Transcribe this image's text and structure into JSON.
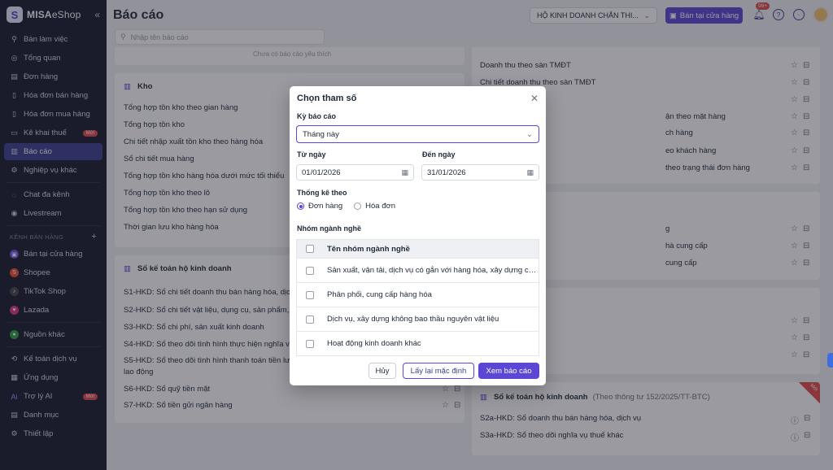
{
  "brand": {
    "name_bold": "MISA",
    "name_light": "eShop"
  },
  "sidebar": {
    "items": [
      {
        "label": "Bàn làm việc",
        "icon": "workspace-icon"
      },
      {
        "label": "Tổng quan",
        "icon": "dashboard-icon"
      },
      {
        "label": "Đơn hàng",
        "icon": "order-icon"
      },
      {
        "label": "Hóa đơn bán hàng",
        "icon": "invoice-icon"
      },
      {
        "label": "Hóa đơn mua hàng",
        "icon": "purchase-invoice-icon"
      },
      {
        "label": "Kê khai thuế",
        "icon": "tax-icon",
        "badge": "Mới"
      },
      {
        "label": "Báo cáo",
        "icon": "report-icon"
      },
      {
        "label": "Nghiệp vụ khác",
        "icon": "other-icon"
      },
      {
        "label": "Chat đa kênh",
        "icon": "chat-icon"
      },
      {
        "label": "Livestream",
        "icon": "livestream-icon"
      }
    ],
    "section_label": "KÊNH BÁN HÀNG",
    "channels": [
      {
        "label": "Bán tại cửa hàng",
        "color": "#6a4fd8"
      },
      {
        "label": "Shopee",
        "color": "#ee4d2d"
      },
      {
        "label": "TikTok Shop",
        "color": "#222222"
      },
      {
        "label": "Lazada",
        "color": "#e0327a"
      }
    ],
    "others": [
      {
        "label": "Nguồn khác",
        "color": "#2ea043"
      },
      {
        "label": "Kế toán dịch vụ",
        "icon": "accounting-icon"
      },
      {
        "label": "Ứng dụng",
        "icon": "apps-icon"
      },
      {
        "label": "Trợ lý AI",
        "icon": "ai-icon",
        "badge": "Mới"
      },
      {
        "label": "Danh mục",
        "icon": "catalog-icon"
      },
      {
        "label": "Thiết lập",
        "icon": "settings-icon"
      }
    ]
  },
  "header": {
    "title": "Báo cáo",
    "search_placeholder": "Nhập tên báo cáo",
    "store": "HỘ KINH DOANH CHẮN THI...",
    "sell_button": "Bán tại cửa hàng",
    "notif_count": "99+"
  },
  "left_top": {
    "empty": "Chưa có báo cáo yêu thích"
  },
  "kho": {
    "title": "Kho",
    "rows": [
      "Tổng hợp tồn kho theo gian hàng",
      "Tổng hợp tồn kho",
      "Chi tiết nhập xuất tồn kho theo hàng hóa",
      "Sổ chi tiết mua hàng",
      "Tổng hợp tồn kho hàng hóa dưới mức tối thiểu",
      "Tổng hợp tồn kho theo lô",
      "Tổng hợp tồn kho theo hạn sử dụng",
      "Thời gian lưu kho hàng hóa"
    ]
  },
  "ledger": {
    "title": "Sổ kế toán hộ kinh doanh",
    "rows": [
      "S1-HKD: Sổ chi tiết doanh thu bán hàng hóa, dịch",
      "S2-HKD: Sổ chi tiết vật liệu, dụng cụ, sản phẩm, h",
      "S3-HKD: Sổ chi phí, sản xuất kinh doanh",
      "S4-HKD: Sổ theo dõi tình hình thực hiện nghĩa vụ",
      "S5-HKD: Sổ theo dõi tình hình thanh toán tiền lươ",
      "lao động",
      "S6-HKD: Sổ quỹ tiền mặt",
      "S7-HKD: Sổ tiền gửi ngân hàng"
    ]
  },
  "right_top": {
    "rows": [
      "Doanh thu theo sàn TMĐT",
      "Chi tiết doanh thu theo sàn TMĐT",
      "ận theo mặt hàng",
      "ch hàng",
      "eo khách hàng",
      "theo trạng thái đơn hàng"
    ]
  },
  "right_mid": {
    "rows": [
      "g",
      "hà cung cấp",
      "cung cấp"
    ]
  },
  "right_ledger": {
    "title": "Sổ kế toán hộ kinh doanh",
    "subtitle": "(Theo thông tư 152/2025/TT-BTC)",
    "ribbon": "Mới",
    "rows": [
      "S2a-HKD: Sổ doanh thu bán hàng hóa, dịch vụ",
      "S3a-HKD: Sổ theo dõi nghĩa vụ thuế khác"
    ]
  },
  "modal": {
    "title": "Chọn tham số",
    "period_label": "Kỳ báo cáo",
    "period_value": "Tháng này",
    "from_label": "Từ ngày",
    "from_value": "01/01/2026",
    "to_label": "Đến ngày",
    "to_value": "31/01/2026",
    "stat_label": "Thống kê theo",
    "radio_order": "Đơn hàng",
    "radio_invoice": "Hóa đơn",
    "group_label": "Nhóm ngành nghề",
    "grid_header": "Tên nhóm ngành nghề",
    "grid_rows": [
      "Sản xuất, vận tải, dịch vụ có gắn với hàng hóa, xây dựng có...",
      "Phân phối, cung cấp hàng hóa",
      "Dịch vụ, xây dựng không bao thầu nguyên vật liệu",
      "Hoạt động kinh doanh khác"
    ],
    "btn_cancel": "Hủy",
    "btn_reset": "Lấy lại mặc định",
    "btn_view": "Xem báo cáo"
  },
  "colors": {
    "accent": "#5b46d6",
    "sidebar_bg": "#171b2d",
    "badge": "#e24a4a"
  }
}
